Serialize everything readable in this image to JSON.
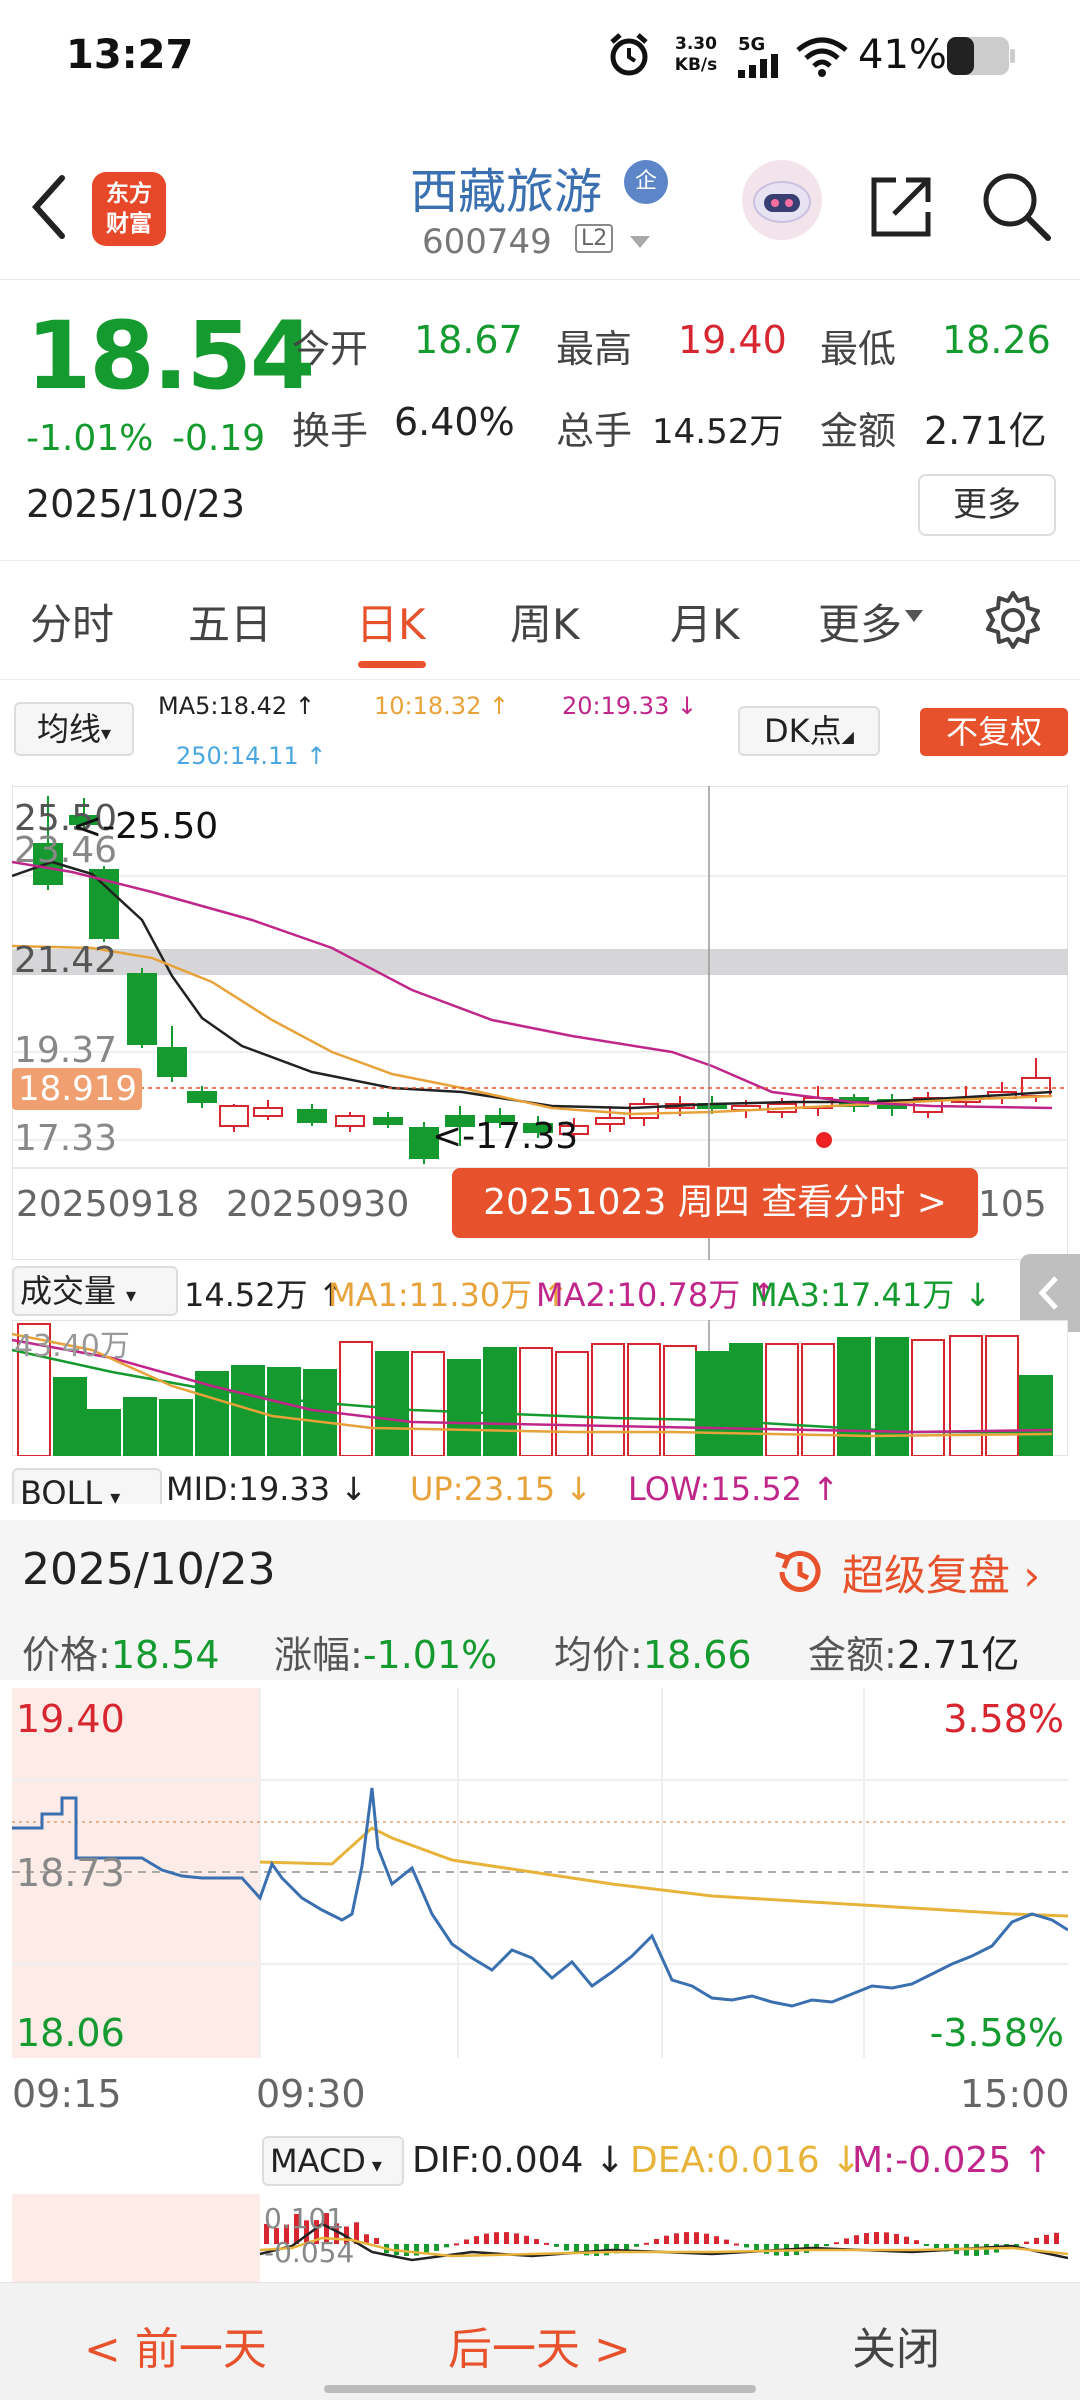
{
  "status_bar": {
    "time": "13:27",
    "net_speed_value": "3.30",
    "net_speed_unit": "KB/s",
    "network": "5G",
    "battery": "41%"
  },
  "header": {
    "logo_line1": "东方",
    "logo_line2": "财富",
    "stock_name": "西藏旅游",
    "badge": "企",
    "stock_code": "600749",
    "level": "L2"
  },
  "quote": {
    "price": "18.54",
    "change_pct": "-1.01%",
    "change": "-0.19",
    "date": "2025/10/23",
    "open_label": "今开",
    "open": "18.67",
    "high_label": "最高",
    "high": "19.40",
    "low_label": "最低",
    "low": "18.26",
    "turnover_label": "换手",
    "turnover": "6.40%",
    "volume_label": "总手",
    "volume": "14.52万",
    "amount_label": "金额",
    "amount": "2.71亿",
    "more": "更多"
  },
  "tabs": [
    {
      "label": "分时",
      "active": false
    },
    {
      "label": "五日",
      "active": false
    },
    {
      "label": "日K",
      "active": true
    },
    {
      "label": "周K",
      "active": false
    },
    {
      "label": "月K",
      "active": false
    },
    {
      "label": "更多",
      "active": false
    }
  ],
  "ma_row": {
    "selector": "均线",
    "ma5": "MA5:18.42 ↑",
    "ma10": "10:18.32 ↑",
    "ma20": "20:19.33 ↓",
    "ma250": "250:14.11 ↑",
    "dk": "DK点",
    "adjust": "不复权",
    "colors": {
      "ma5": "#222222",
      "ma10": "#e8a23a",
      "ma20": "#c0268a",
      "ma250": "#4aa7e0"
    }
  },
  "kline": {
    "y_labels": [
      "25.50",
      "23.46",
      "21.42",
      "19.37",
      "17.33"
    ],
    "crosshair_price": "18.919",
    "max_label": "<-25.50",
    "min_label": "<-17.33",
    "x_labels": [
      "20250918",
      "20250930",
      "105"
    ],
    "banner": "20251023 周四 查看分时 >"
  },
  "volume": {
    "selector": "成交量",
    "vol": "14.52万 ↑",
    "ma1": "MA1:11.30万 ↑",
    "ma2": "MA2:10.78万 ↑",
    "ma3": "MA3:17.41万 ↓",
    "max_label": "43.40万"
  },
  "boll": {
    "selector": "BOLL",
    "mid": "MID:19.33 ↓",
    "up": "UP:23.15 ↓",
    "low": "LOW:15.52 ↑"
  },
  "detail": {
    "date": "2025/10/23",
    "super_review": "超级复盘",
    "price_label": "价格:",
    "price": "18.54",
    "chg_label": "涨幅:",
    "chg": "-1.01%",
    "avg_label": "均价:",
    "avg": "18.66",
    "amt_label": "金额:",
    "amt": "2.71亿"
  },
  "intraday": {
    "high": "19.40",
    "mid": "18.73",
    "low": "18.06",
    "pct_up": "3.58%",
    "pct_down": "-3.58%",
    "times": [
      "09:15",
      "09:30",
      "15:00"
    ]
  },
  "macd": {
    "selector": "MACD",
    "dif": "DIF:0.004 ↓",
    "dea": "DEA:0.016 ↓",
    "m": "M:-0.025 ↑",
    "top": "0.101",
    "bottom": "-0.054"
  },
  "bottom_bar": {
    "prev": "< 前一天",
    "next": "后一天 >",
    "close": "关闭"
  }
}
